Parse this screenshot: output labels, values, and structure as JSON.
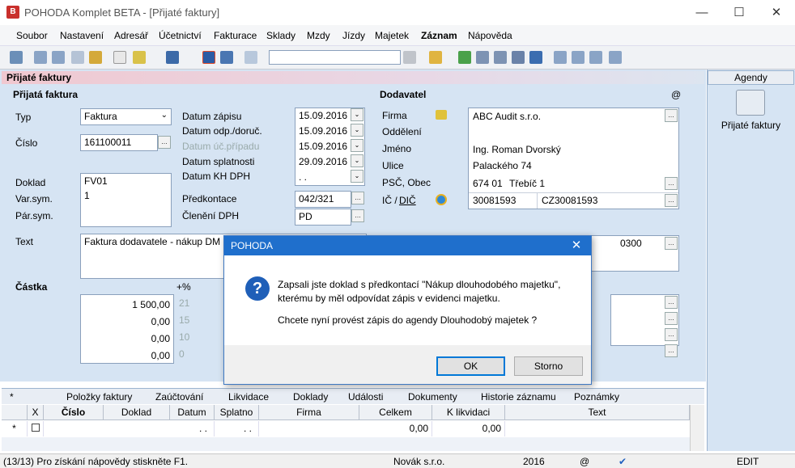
{
  "window": {
    "title": "POHODA Komplet BETA - [Přijaté faktury]",
    "app_icon": "B"
  },
  "menu": [
    "Soubor",
    "Nastavení",
    "Adresář",
    "Účetnictví",
    "Fakturace",
    "Sklady",
    "Mzdy",
    "Jízdy",
    "Majetek",
    "Záznam",
    "Nápověda"
  ],
  "section_header": "Přijaté faktury",
  "agenda": {
    "header": "Agendy",
    "item": "Přijaté faktury"
  },
  "form": {
    "section_title": "Přijatá faktura",
    "typ_label": "Typ",
    "typ_value": "Faktura",
    "cislo_label": "Číslo",
    "cislo_value": "161100011",
    "doklad_label": "Doklad",
    "doklad_value": "FV01",
    "varsym_label": "Var.sym.",
    "varsym_value": "1",
    "parsym_label": "Pár.sym.",
    "datum_zapisu_label": "Datum zápisu",
    "datum_zapisu": "15.09.2016",
    "datum_odp_label": "Datum odp./doruč.",
    "datum_odp": "15.09.2016",
    "datum_uc_label": "Datum úč.případu",
    "datum_uc": "15.09.2016",
    "datum_splat_label": "Datum splatnosti",
    "datum_splat": "29.09.2016",
    "datum_kh_label": "Datum KH DPH",
    "datum_kh": ". .",
    "predkontace_label": "Předkontace",
    "predkontace": "042/321",
    "cleneni_label": "Členění DPH",
    "cleneni": "PD",
    "text_label": "Text",
    "text_value": "Faktura dodavatele - nákup DM",
    "castka_label": "Částka",
    "pct_label": "+%",
    "amounts": [
      "1 500,00",
      "0,00",
      "0,00",
      "0,00"
    ],
    "rates": [
      "21",
      "15",
      "10",
      "0"
    ],
    "right_code": "0300"
  },
  "supplier": {
    "title": "Dodavatel",
    "at": "@",
    "firma_label": "Firma",
    "firma": "ABC Audit s.r.o.",
    "oddeleni_label": "Oddělení",
    "jmeno_label": "Jméno",
    "jmeno": "Ing. Roman Dvorský",
    "ulice_label": "Ulice",
    "ulice": "Palackého 74",
    "psc_label": "PSČ, Obec",
    "psc": "674 01",
    "obec": "Třebíč 1",
    "ic_label": "IČ /",
    "dic_label": "DIČ",
    "ic": "30081593",
    "dic": "CZ30081593"
  },
  "dialog": {
    "title": "POHODA",
    "line1": "Zapsali jste doklad s předkontací \"Nákup dlouhodobého majetku\",",
    "line2": "kterému by měl odpovídat zápis v evidenci majetku.",
    "line3": "Chcete nyní provést zápis do agendy Dlouhodobý majetek ?",
    "ok": "OK",
    "cancel": "Storno"
  },
  "tabs": [
    "*",
    "Položky faktury",
    "Zaúčtování",
    "Likvidace",
    "Doklady",
    "Události",
    "Dokumenty",
    "Historie záznamu",
    "Poznámky"
  ],
  "grid": {
    "headers": [
      "X",
      "Číslo",
      "Doklad",
      "Datum",
      "Splatno",
      "Firma",
      "Celkem",
      "K likvidaci",
      "Text"
    ],
    "row": {
      "marker": "*",
      "datum": ". .",
      "splatno": ". .",
      "celkem": "0,00",
      "k_likvidaci": "0,00"
    }
  },
  "status": {
    "help": "(13/13) Pro získání nápovědy stiskněte F1.",
    "company": "Novák s.r.o.",
    "year": "2016",
    "at": "@",
    "mode": "EDIT"
  }
}
